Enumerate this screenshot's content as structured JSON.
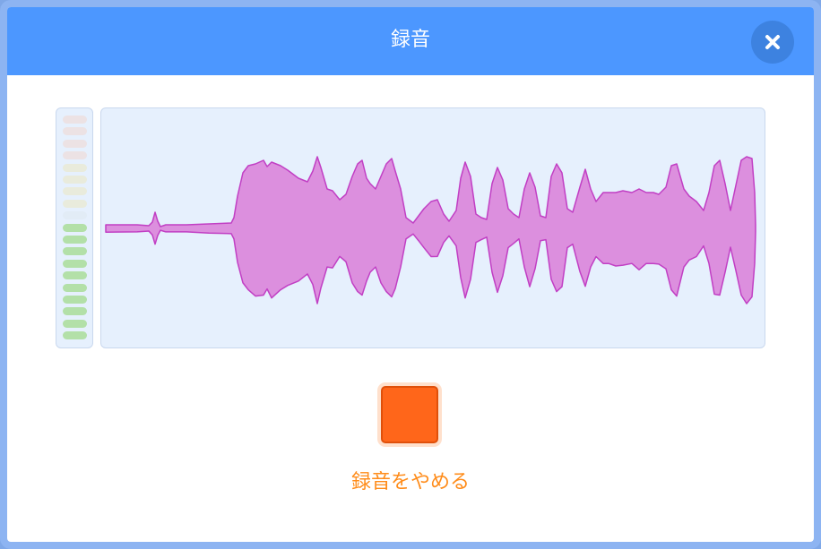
{
  "dialog": {
    "title": "録音",
    "close_icon": "close-icon"
  },
  "level_meter": {
    "segment_count": 19,
    "active_segments": 10,
    "colors": {
      "active": "#b3e0a8",
      "low_idle": "#e2ecf6",
      "mid_idle": "#e9ebdc",
      "high_idle": "#ece2e4"
    }
  },
  "waveform": {
    "fill_color": "#dc8fde",
    "stroke_color": "#c13fc4",
    "background": "#e6f0fd"
  },
  "stop_control": {
    "icon": "stop-icon",
    "color": "#ff661a",
    "label": "録音をやめる",
    "label_color": "#ff8c1a"
  },
  "colors": {
    "header": "#4c97ff",
    "close_button": "#3d82e0"
  }
}
